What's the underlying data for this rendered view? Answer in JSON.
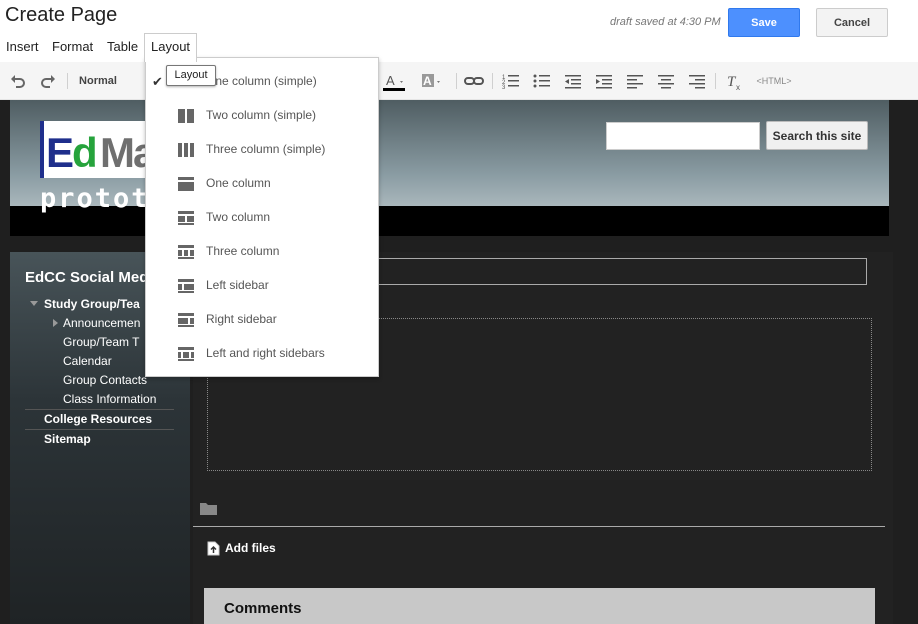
{
  "header": {
    "title": "Create Page",
    "draft_status": "draft saved at 4:30 PM",
    "save_label": "Save",
    "cancel_label": "Cancel",
    "save_color": "#4d90fe"
  },
  "menus": [
    {
      "label": "Insert"
    },
    {
      "label": "Format"
    },
    {
      "label": "Table"
    },
    {
      "label": "Layout",
      "active": true
    }
  ],
  "toolbar": {
    "style_select": "Normal",
    "html_button": "<HTML>",
    "icons": [
      "undo-icon",
      "redo-icon",
      "text-color-icon",
      "highlight-color-icon",
      "link-icon",
      "numbered-list-icon",
      "bulleted-list-icon",
      "indent-less-icon",
      "indent-more-icon",
      "align-left-icon",
      "align-center-icon",
      "align-right-icon",
      "clear-formatting-icon"
    ]
  },
  "tooltip": {
    "text": "Layout"
  },
  "layout_menu": {
    "items": [
      {
        "label": "One column (simple)",
        "checked": true,
        "icon": "one-column-simple-icon"
      },
      {
        "label": "Two column (simple)",
        "icon": "two-column-simple-icon"
      },
      {
        "label": "Three column (simple)",
        "icon": "three-column-simple-icon"
      },
      {
        "label": "One column",
        "icon": "one-column-icon"
      },
      {
        "label": "Two column",
        "icon": "two-column-icon"
      },
      {
        "label": "Three column",
        "icon": "three-column-icon"
      },
      {
        "label": "Left sidebar",
        "icon": "left-sidebar-icon"
      },
      {
        "label": "Right sidebar",
        "icon": "right-sidebar-icon"
      },
      {
        "label": "Left and right sidebars",
        "icon": "left-right-sidebars-icon"
      }
    ]
  },
  "site": {
    "logo_ed_e": "E",
    "logo_ed_d": "d",
    "logo_rest": "Ma",
    "title": "prototy         o",
    "search_button": "Search this site",
    "sidebar_title": "EdCC Social Med",
    "nav": {
      "study_group": "Study Group/Tea",
      "announcements": "Announcemen",
      "group_team": "Group/Team T",
      "calendar": "Calendar",
      "group_contacts": "Group Contacts",
      "class_information": "Class Information",
      "college_resources": "College Resources",
      "sitemap": "Sitemap"
    },
    "add_files": "Add files",
    "comments": "Comments"
  }
}
